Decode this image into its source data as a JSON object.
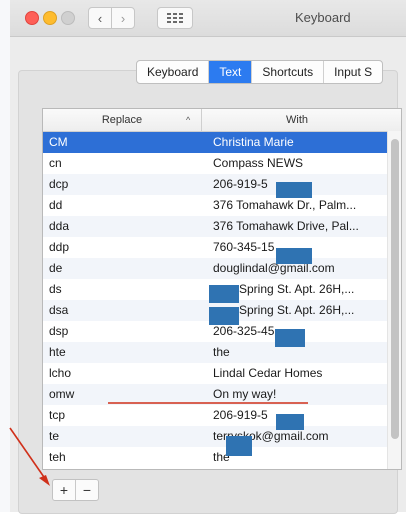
{
  "window": {
    "title": "Keyboard",
    "nav_back_icon": "‹",
    "nav_forward_icon": "›"
  },
  "tabs": [
    {
      "label": "Keyboard"
    },
    {
      "label": "Text",
      "active": true
    },
    {
      "label": "Shortcuts"
    },
    {
      "label": "Input S"
    }
  ],
  "table": {
    "columns": {
      "replace": "Replace",
      "with": "With"
    },
    "sort_indicator": "^",
    "rows": [
      {
        "replace": "CM",
        "with": "Christina Marie",
        "selected": true
      },
      {
        "replace": "cn",
        "with": "Compass NEWS"
      },
      {
        "replace": "dcp",
        "with": "206-919-5"
      },
      {
        "replace": "dd",
        "with": "376 Tomahawk Dr., Palm..."
      },
      {
        "replace": "dda",
        "with": "376 Tomahawk Drive, Pal..."
      },
      {
        "replace": "ddp",
        "with": "760-345-15"
      },
      {
        "replace": "de",
        "with": "douglindal@gmail.com"
      },
      {
        "replace": "ds",
        "with": "Spring St. Apt. 26H,..."
      },
      {
        "replace": "dsa",
        "with": "Spring St. Apt. 26H,..."
      },
      {
        "replace": "dsp",
        "with": "206-325-45"
      },
      {
        "replace": "hte",
        "with": "the"
      },
      {
        "replace": "lcho",
        "with": "Lindal Cedar Homes"
      },
      {
        "replace": "omw",
        "with": "On my way!"
      },
      {
        "replace": "tcp",
        "with": "206-919-5"
      },
      {
        "replace": "te",
        "with": "terryskok@gmail.com"
      },
      {
        "replace": "teh",
        "with": "the"
      }
    ]
  },
  "buttons": {
    "add": "+",
    "remove": "−"
  },
  "colors": {
    "accent": "#2c7bf0",
    "selection": "#2d6fd6",
    "annotation": "#d0301a",
    "redaction": "#2f73b2"
  }
}
